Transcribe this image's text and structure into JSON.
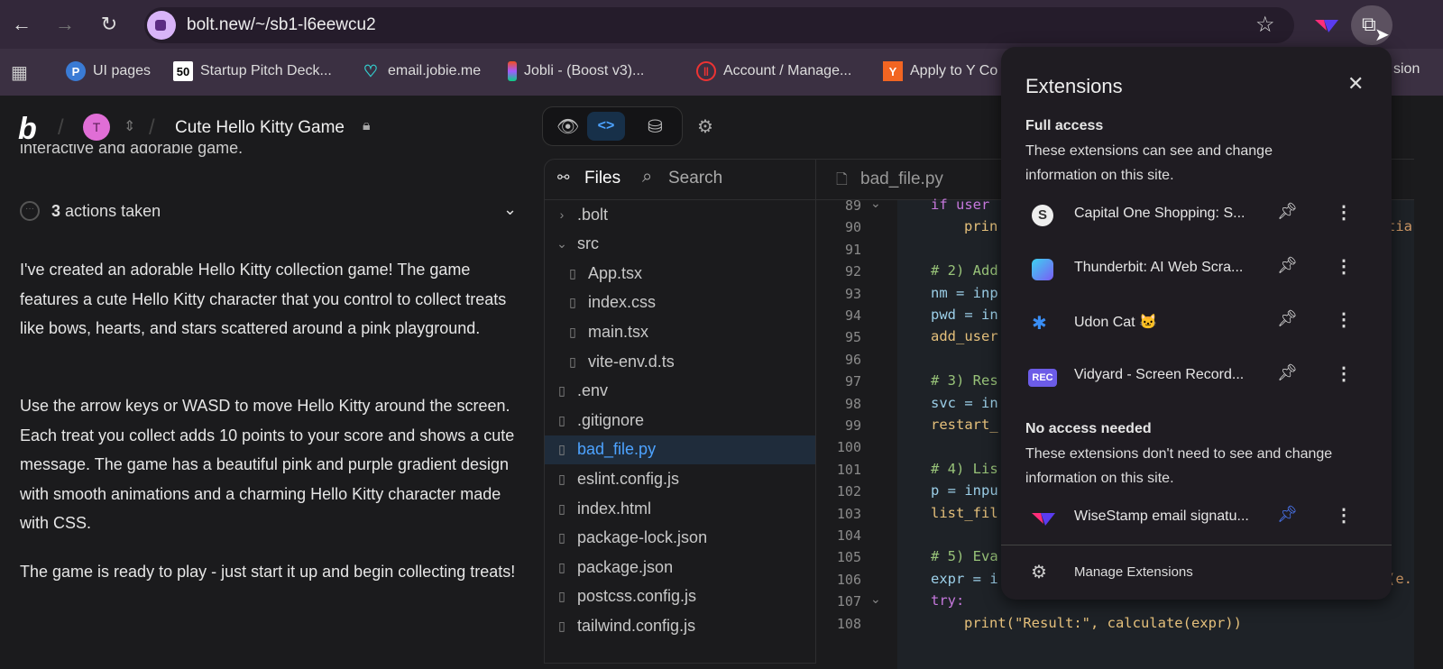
{
  "browser": {
    "url": "bolt.new/~/sb1-l6eewcu2",
    "bookmarks": [
      {
        "label": "UI pages",
        "icon": "p-circle-icon"
      },
      {
        "label": "Startup Pitch Deck...",
        "icon": "fifty-icon"
      },
      {
        "label": "email.jobie.me",
        "icon": "heart-logo-icon"
      },
      {
        "label": "Jobli - (Boost v3)...",
        "icon": "figma-icon"
      },
      {
        "label": "Account / Manage...",
        "icon": "red-circle-icon"
      },
      {
        "label": "Apply to Y Co",
        "icon": "ycombinator-icon"
      },
      {
        "label": "sion",
        "icon": ""
      }
    ]
  },
  "app": {
    "project_avatar": "T",
    "project_title": "Cute Hello Kitty Game",
    "actions_taken_count": "3",
    "actions_taken_label": "actions taken",
    "clipped_text": "interactive and adorable game.",
    "messages": [
      "I've created an adorable Hello Kitty collection game! The game features a cute Hello Kitty character that you control to collect treats like bows, hearts, and stars scattered around a pink playground.",
      "Use the arrow keys or WASD to move Hello Kitty around the screen. Each treat you collect adds 10 points to your score and shows a cute message. The game has a beautiful pink and purple gradient design with smooth animations and a charming Hello Kitty character made with CSS.",
      "The game is ready to play - just start it up and begin collecting treats!"
    ]
  },
  "workbench": {
    "files_tab": "Files",
    "search_tab": "Search",
    "open_file": "bad_file.py",
    "tree": [
      {
        "name": ".bolt",
        "type": "folder",
        "open": false,
        "depth": 0
      },
      {
        "name": "src",
        "type": "folder",
        "open": true,
        "depth": 0
      },
      {
        "name": "App.tsx",
        "type": "file",
        "depth": 1
      },
      {
        "name": "index.css",
        "type": "file",
        "depth": 1
      },
      {
        "name": "main.tsx",
        "type": "file",
        "depth": 1
      },
      {
        "name": "vite-env.d.ts",
        "type": "file",
        "depth": 1
      },
      {
        "name": ".env",
        "type": "file",
        "depth": 0
      },
      {
        "name": ".gitignore",
        "type": "file",
        "depth": 0
      },
      {
        "name": "bad_file.py",
        "type": "file",
        "depth": 0,
        "selected": true
      },
      {
        "name": "eslint.config.js",
        "type": "file",
        "depth": 0
      },
      {
        "name": "index.html",
        "type": "file",
        "depth": 0
      },
      {
        "name": "package-lock.json",
        "type": "file",
        "depth": 0
      },
      {
        "name": "package.json",
        "type": "file",
        "depth": 0
      },
      {
        "name": "postcss.config.js",
        "type": "file",
        "depth": 0
      },
      {
        "name": "tailwind.config.js",
        "type": "file",
        "depth": 0
      }
    ],
    "code": [
      {
        "n": "89",
        "fold": true,
        "indent": 1,
        "text": "if user",
        "cls": "kw"
      },
      {
        "n": "90",
        "indent": 2,
        "text": "prin",
        "cls": "fn",
        "tail": "tia"
      },
      {
        "n": "91",
        "text": ""
      },
      {
        "n": "92",
        "indent": 1,
        "text": "# 2) Add",
        "cls": "cm"
      },
      {
        "n": "93",
        "indent": 1,
        "text": "nm = inp"
      },
      {
        "n": "94",
        "indent": 1,
        "text": "pwd = in"
      },
      {
        "n": "95",
        "indent": 1,
        "text": "add_user",
        "cls": "fn"
      },
      {
        "n": "96",
        "text": ""
      },
      {
        "n": "97",
        "indent": 1,
        "text": "# 3) Res",
        "cls": "cm"
      },
      {
        "n": "98",
        "indent": 1,
        "text": "svc = in"
      },
      {
        "n": "99",
        "indent": 1,
        "text": "restart_",
        "cls": "fn"
      },
      {
        "n": "100",
        "text": ""
      },
      {
        "n": "101",
        "indent": 1,
        "text": "# 4) Lis",
        "cls": "cm"
      },
      {
        "n": "102",
        "indent": 1,
        "text": "p = inpu"
      },
      {
        "n": "103",
        "indent": 1,
        "text": "list_fil",
        "cls": "fn"
      },
      {
        "n": "104",
        "text": ""
      },
      {
        "n": "105",
        "indent": 1,
        "text": "# 5) Eva",
        "cls": "cm"
      },
      {
        "n": "106",
        "indent": 1,
        "text": "expr = i",
        "tail": "(e."
      },
      {
        "n": "107",
        "fold": true,
        "indent": 1,
        "text": "try:",
        "cls": "kw"
      },
      {
        "n": "108",
        "indent": 2,
        "text": "print(\"Result:\", calculate(expr))",
        "cls": "fn"
      }
    ]
  },
  "extensions_popup": {
    "title": "Extensions",
    "full_access_heading": "Full access",
    "full_access_desc": "These extensions can see and change information on this site.",
    "full_access": [
      {
        "name": "Capital One Shopping: S...",
        "icon": "capital-one-icon",
        "pinned": true
      },
      {
        "name": "Thunderbit: AI Web Scra...",
        "icon": "thunderbit-icon",
        "pinned": true
      },
      {
        "name": "Udon Cat 🐱",
        "icon": "puzzle-icon",
        "pinned": true
      },
      {
        "name": "Vidyard - Screen Record...",
        "icon": "vidyard-rec-icon",
        "rec_label": "REC",
        "pinned": true
      }
    ],
    "no_access_heading": "No access needed",
    "no_access_desc": "These extensions don't need to see and change information on this site.",
    "no_access": [
      {
        "name": "WiseStamp email signatu...",
        "icon": "wisestamp-icon",
        "pinned": false
      }
    ],
    "manage_label": "Manage Extensions"
  },
  "colors": {
    "accent": "#3b82f6",
    "selected_file": "#4da3ff",
    "popup_bg": "#1f1c22"
  }
}
